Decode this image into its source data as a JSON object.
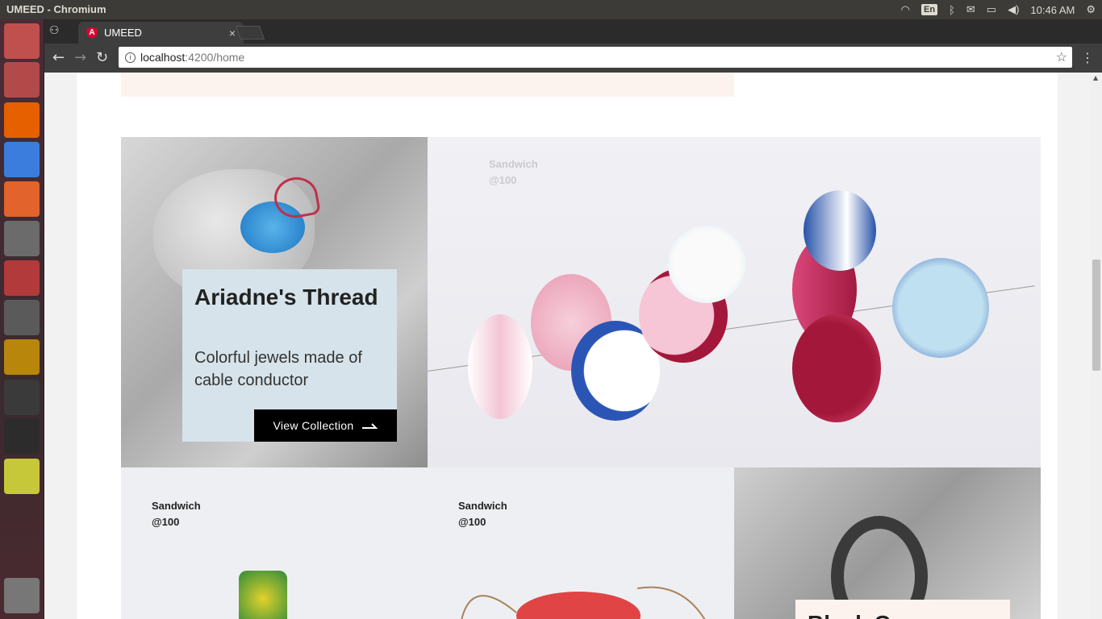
{
  "os": {
    "window_title": "UMEED - Chromium",
    "keyboard_layout": "En",
    "clock": "10:46 AM"
  },
  "browser": {
    "tab_title": "UMEED",
    "tab_favicon": "A",
    "tab_close": "×",
    "url_host": "localhost",
    "url_rest": ":4200/home"
  },
  "launcher": [
    {
      "name": "ubuntu-dash-icon",
      "color": "#c0504d"
    },
    {
      "name": "files-icon",
      "color": "#b34a4a"
    },
    {
      "name": "firefox-icon",
      "color": "#e66000"
    },
    {
      "name": "chromium-icon",
      "color": "#3b7ddd"
    },
    {
      "name": "software-center-icon",
      "color": "#e2632b"
    },
    {
      "name": "calculator-icon",
      "color": "#6b6b6b"
    },
    {
      "name": "settings-tool-icon",
      "color": "#b33a3a"
    },
    {
      "name": "installer-icon",
      "color": "#5a5a5a"
    },
    {
      "name": "sublime-text-icon",
      "color": "#b8860b"
    },
    {
      "name": "system-monitor-icon",
      "color": "#3a3a3a"
    },
    {
      "name": "terminal-icon",
      "color": "#2c2c2c"
    },
    {
      "name": "document-viewer-icon",
      "color": "#c7c73a"
    },
    {
      "name": "trash-icon",
      "color": "#777777"
    }
  ],
  "feature": {
    "title": "Ariadne's Thread",
    "description": "Colorful jewels made of cable conductor",
    "cta": "View Collection",
    "card_color": "#d6e3ea"
  },
  "products": [
    {
      "name": "Sandwich",
      "price": "@100"
    },
    {
      "name": "Sandwich",
      "price": "@100"
    },
    {
      "name": "Sandwich",
      "price": "@100"
    }
  ],
  "second_feature": {
    "title_partial": "Black C"
  }
}
